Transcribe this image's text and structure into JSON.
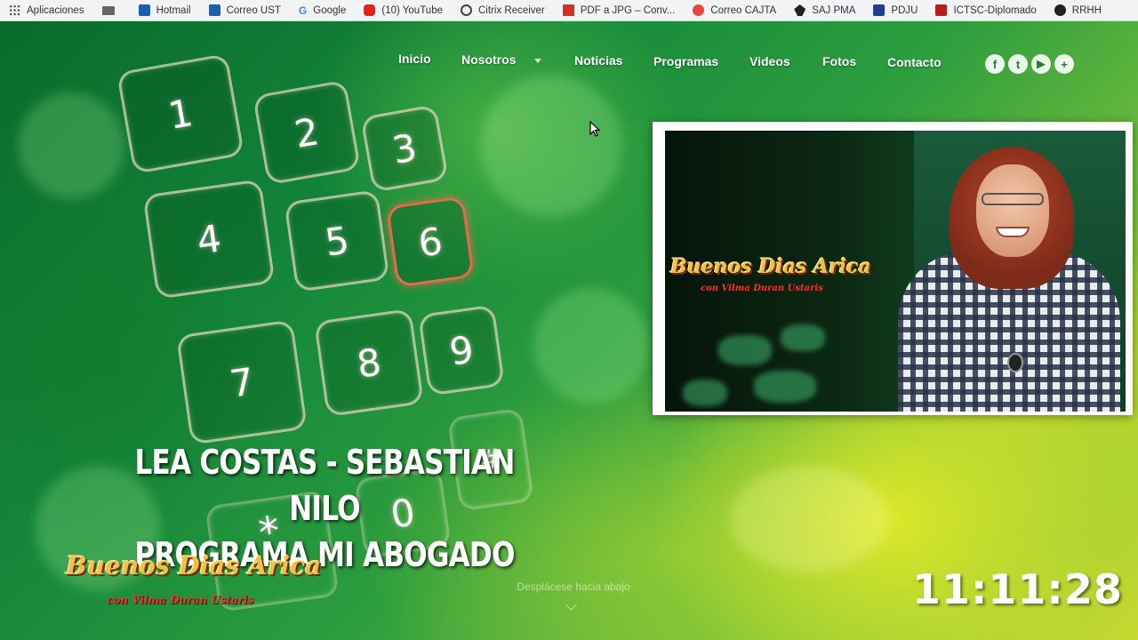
{
  "bookmarks": [
    {
      "label": "Aplicaciones",
      "icon": "apps-grid-icon"
    },
    {
      "label": "",
      "icon": "folder-icon"
    },
    {
      "label": "Hotmail",
      "icon": "outlook-icon"
    },
    {
      "label": "Correo UST",
      "icon": "outlook-icon"
    },
    {
      "label": "Google",
      "icon": "google-icon"
    },
    {
      "label": "(10) YouTube",
      "icon": "youtube-icon"
    },
    {
      "label": "Citrix Receiver",
      "icon": "citrix-icon"
    },
    {
      "label": "PDF a JPG – Conv...",
      "icon": "pdf-icon"
    },
    {
      "label": "Correo CAJTA",
      "icon": "mail-icon"
    },
    {
      "label": "SAJ PMA",
      "icon": "shield-icon"
    },
    {
      "label": "PDJU",
      "icon": "institution-icon"
    },
    {
      "label": "ICTSC-Diplomado",
      "icon": "ictsc-icon"
    },
    {
      "label": "RRHH",
      "icon": "globe-icon"
    }
  ],
  "nav": {
    "items": [
      "Inicio",
      "Nosotros",
      "Noticias",
      "Programas",
      "Videos",
      "Fotos",
      "Contacto"
    ],
    "social": [
      "f",
      "t",
      "▶",
      "+"
    ]
  },
  "keypad": [
    "1",
    "2",
    "3",
    "4",
    "5",
    "6",
    "7",
    "8",
    "9",
    "*",
    "0",
    "#"
  ],
  "headline": {
    "line1": "LEA COSTAS - SEBASTIAN NILO",
    "line2": "PROGRAMA MI ABOGADO"
  },
  "logo": {
    "title": "Buenos Dias Arica",
    "subtitle": "con Vilma Duran Ustaris"
  },
  "scroll_hint": "Desplácese hacia abajo",
  "clock": "11:11:28"
}
